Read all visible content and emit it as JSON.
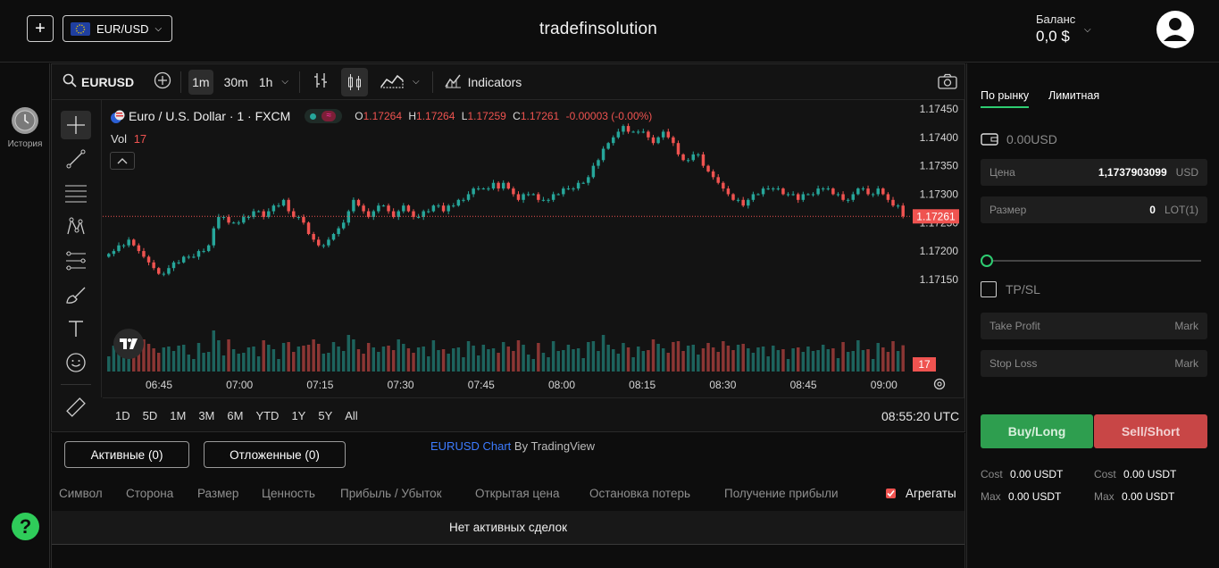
{
  "header": {
    "plus_label": "+",
    "pair_label": "EUR/USD",
    "site_title": "tradefinsolution",
    "balance_label": "Баланс",
    "balance_value": "0,0 $"
  },
  "sidebar": {
    "history_label": "История",
    "help_label": "?"
  },
  "chart_toolbar": {
    "symbol": "EURUSD",
    "intervals": [
      "1m",
      "30m",
      "1h"
    ],
    "active_interval": "1m",
    "indicators_label": "Indicators"
  },
  "legend": {
    "title": "Euro / U.S. Dollar · 1 · FXCM",
    "o_label": "O",
    "o_value": "1.17264",
    "h_label": "H",
    "h_value": "1.17264",
    "l_label": "L",
    "l_value": "1.17259",
    "c_label": "C",
    "c_value": "1.17261",
    "change": "-0.00003 (-0.00%)",
    "vol_label": "Vol",
    "vol_value": "17"
  },
  "colors": {
    "up": "#26a69a",
    "down": "#ef5350",
    "buy": "#2e9e4f",
    "sell": "#c84646",
    "accent": "#2ecc71"
  },
  "chart_data": {
    "type": "candlestick",
    "ylim": [
      1.1712,
      1.1745
    ],
    "y_ticks": [
      "1.17450",
      "1.17400",
      "1.17350",
      "1.17300",
      "1.17250",
      "1.17200",
      "1.17150"
    ],
    "x_ticks": [
      "06:45",
      "07:00",
      "07:15",
      "07:30",
      "07:45",
      "08:00",
      "08:15",
      "08:30",
      "08:45",
      "09:00"
    ],
    "last_price": "1.17261",
    "last_volume": "17",
    "closes": [
      1.17195,
      1.172,
      1.1721,
      1.1721,
      1.1722,
      1.1721,
      1.172,
      1.1719,
      1.1718,
      1.1717,
      1.1716,
      1.1716,
      1.1717,
      1.1718,
      1.1718,
      1.1719,
      1.1719,
      1.1719,
      1.172,
      1.172,
      1.1721,
      1.1724,
      1.1726,
      1.1726,
      1.1725,
      1.1725,
      1.1725,
      1.1726,
      1.1726,
      1.1727,
      1.1727,
      1.1726,
      1.1727,
      1.1728,
      1.1728,
      1.1729,
      1.1727,
      1.1726,
      1.1726,
      1.1725,
      1.1723,
      1.1722,
      1.1721,
      1.1721,
      1.1722,
      1.1723,
      1.1724,
      1.1725,
      1.1727,
      1.1729,
      1.1728,
      1.1727,
      1.1726,
      1.1727,
      1.1728,
      1.1728,
      1.1727,
      1.1726,
      1.1727,
      1.1728,
      1.1727,
      1.1726,
      1.1726,
      1.1727,
      1.1727,
      1.1728,
      1.1728,
      1.1727,
      1.1728,
      1.1728,
      1.1729,
      1.1729,
      1.173,
      1.1731,
      1.1731,
      1.1731,
      1.1731,
      1.1732,
      1.1731,
      1.1732,
      1.1731,
      1.173,
      1.1729,
      1.173,
      1.173,
      1.173,
      1.1729,
      1.1729,
      1.1729,
      1.173,
      1.173,
      1.1731,
      1.1731,
      1.1731,
      1.1732,
      1.1732,
      1.1733,
      1.1735,
      1.1736,
      1.1738,
      1.1739,
      1.174,
      1.1741,
      1.1742,
      1.1741,
      1.1741,
      1.1741,
      1.1741,
      1.174,
      1.1739,
      1.174,
      1.1741,
      1.174,
      1.1739,
      1.1737,
      1.1736,
      1.1736,
      1.1737,
      1.1737,
      1.1735,
      1.1734,
      1.1733,
      1.1732,
      1.1731,
      1.173,
      1.1729,
      1.1729,
      1.1728,
      1.1729,
      1.173,
      1.173,
      1.1731,
      1.1731,
      1.1731,
      1.1731,
      1.173,
      1.173,
      1.173,
      1.1729,
      1.173,
      1.173,
      1.173,
      1.1731,
      1.1731,
      1.1731,
      1.173,
      1.173,
      1.1729,
      1.1729,
      1.173,
      1.1731,
      1.1731,
      1.173,
      1.173,
      1.1731,
      1.173,
      1.1729,
      1.1728,
      1.1728,
      1.17261
    ]
  },
  "range_bar": {
    "ranges": [
      "1D",
      "5D",
      "1M",
      "3M",
      "6M",
      "YTD",
      "1Y",
      "5Y",
      "All"
    ],
    "clock": "08:55:20 UTC"
  },
  "credit": {
    "link": "EURUSD Chart",
    "by": "By TradingView"
  },
  "orders": {
    "tab_active": "Активные (0)",
    "tab_pending": "Отложенные (0)",
    "columns": [
      "Символ",
      "Сторона",
      "Размер",
      "Ценность",
      "Прибыль / Убыток",
      "Открытая цена",
      "Остановка потерь",
      "Получение прибыли"
    ],
    "aggregates_label": "Агрегаты",
    "empty_text": "Нет активных сделок"
  },
  "trade": {
    "tab_market": "По рынку",
    "tab_limit": "Лимитная",
    "wallet_value": "0.00USD",
    "price_label": "Цена",
    "price_value": "1,1737903099",
    "price_unit": "USD",
    "size_label": "Размер",
    "size_value": "0",
    "size_unit": "LOT(1)",
    "slider_value": 0,
    "tpsl_label": "TP/SL",
    "tp_label": "Take Profit",
    "tp_unit": "Mark",
    "sl_label": "Stop Loss",
    "sl_unit": "Mark",
    "buy_label": "Buy/Long",
    "sell_label": "Sell/Short",
    "cost_label": "Cost",
    "cost_buy": "0.00 USDT",
    "cost_sell": "0.00 USDT",
    "max_label": "Max",
    "max_buy": "0.00 USDT",
    "max_sell": "0.00 USDT"
  }
}
